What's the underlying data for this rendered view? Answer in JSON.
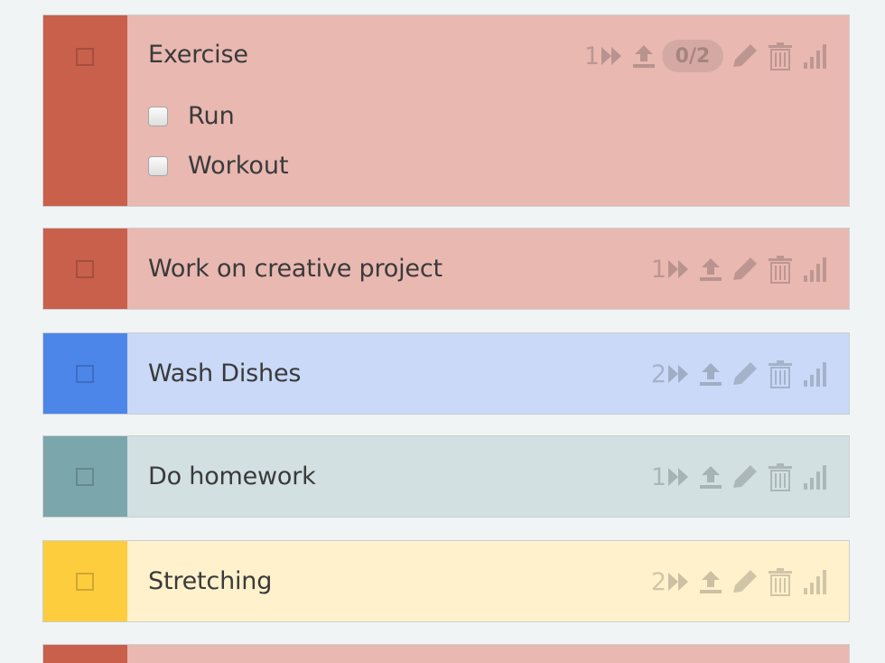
{
  "tasks": [
    {
      "title": "Exercise",
      "count": "1",
      "badge": "0/2",
      "strip_color": "#c8604b",
      "body_color": "#e8b8b1",
      "subtasks": [
        {
          "label": "Run"
        },
        {
          "label": "Workout"
        }
      ]
    },
    {
      "title": "Work on creative project",
      "count": "1",
      "strip_color": "#c8604b",
      "body_color": "#e8b8b1"
    },
    {
      "title": "Wash Dishes",
      "count": "2",
      "strip_color": "#4d86e9",
      "body_color": "#c9d9f7"
    },
    {
      "title": "Do homework",
      "count": "1",
      "strip_color": "#7ba6ac",
      "body_color": "#d2e0e2"
    },
    {
      "title": "Stretching",
      "count": "2",
      "strip_color": "#fdcd3e",
      "body_color": "#fff1cc"
    },
    {
      "title": "",
      "strip_color": "#c8604b",
      "body_color": "#e8b8b1"
    }
  ],
  "icons": [
    "fast-forward-icon",
    "upload-icon",
    "pencil-icon",
    "trash-icon",
    "signal-bars-icon"
  ]
}
